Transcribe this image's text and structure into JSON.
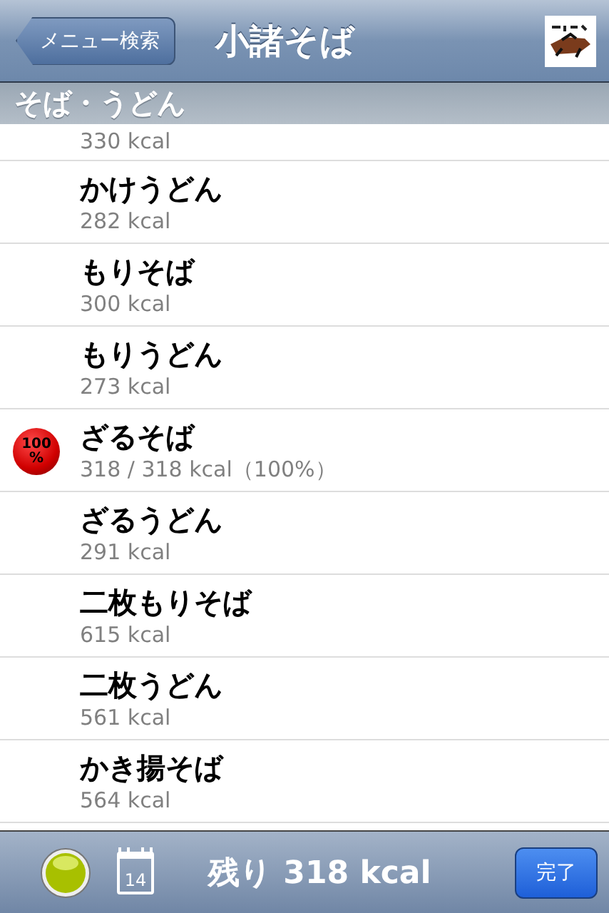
{
  "nav": {
    "back": "メニュー検索",
    "title": "小諸そば"
  },
  "section": "そば・うどん",
  "items": [
    {
      "kcal": "330 kcal"
    },
    {
      "name": "かけうどん",
      "kcal": "282 kcal"
    },
    {
      "name": "もりそば",
      "kcal": "300 kcal"
    },
    {
      "name": "もりうどん",
      "kcal": "273 kcal"
    },
    {
      "name": "ざるそば",
      "kcal": "318 / 318 kcal（100%）",
      "badge": [
        "100",
        "%"
      ]
    },
    {
      "name": "ざるうどん",
      "kcal": "291 kcal"
    },
    {
      "name": "二枚もりそば",
      "kcal": "615 kcal"
    },
    {
      "name": "二枚うどん",
      "kcal": "561 kcal"
    },
    {
      "name": "かき揚そば",
      "kcal": "564 kcal"
    }
  ],
  "toolbar": {
    "day": "14",
    "remaining": "残り 318 kcal",
    "done": "完了"
  }
}
